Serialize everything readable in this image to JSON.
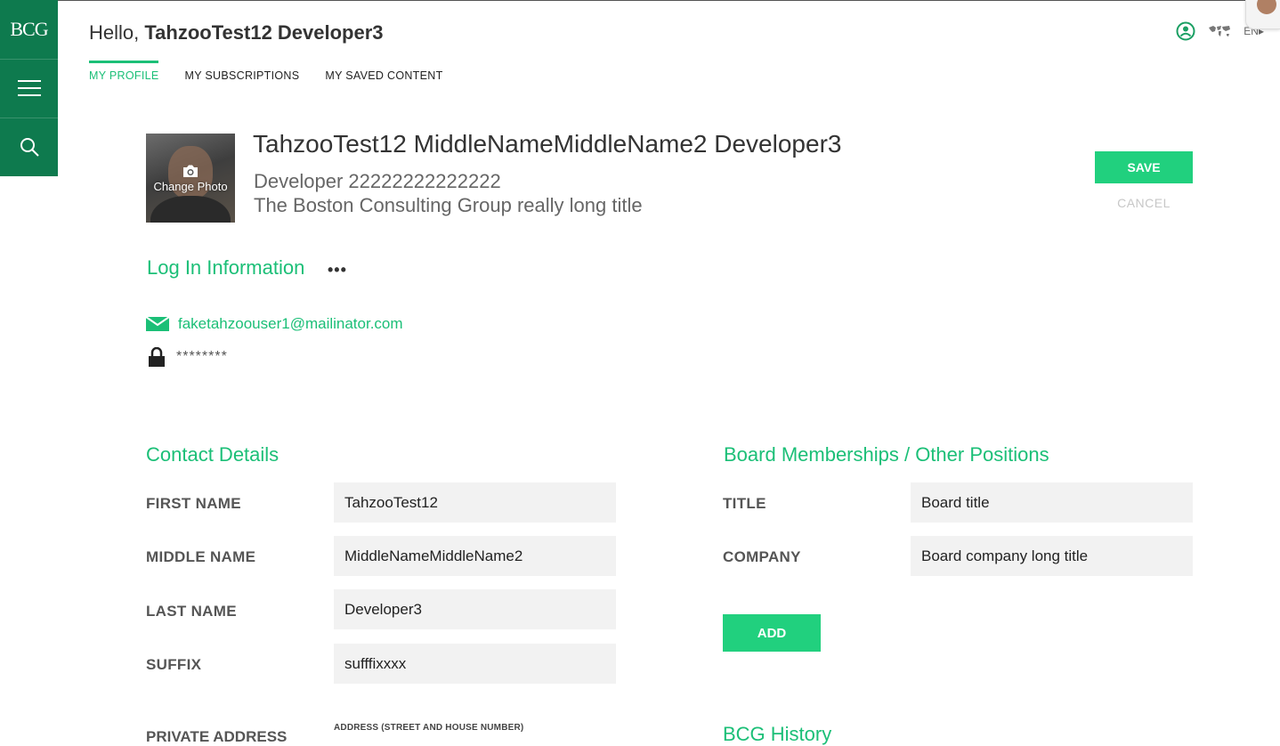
{
  "brand": {
    "logo_text": "BCG",
    "accent": "#1bbf77",
    "button_green": "#21d07e",
    "rail_green": "#0e7a4e"
  },
  "rail": {
    "menu_icon": "hamburger-icon",
    "search_icon": "search-icon"
  },
  "header": {
    "greeting": "Hello,",
    "user_name": "TahzooTest12 Developer3",
    "language": "EN",
    "tabs": [
      {
        "label": "MY PROFILE",
        "active": true
      },
      {
        "label": "MY SUBSCRIPTIONS",
        "active": false
      },
      {
        "label": "MY SAVED CONTENT",
        "active": false
      }
    ]
  },
  "profile": {
    "change_photo": "Change Photo",
    "full_name": "TahzooTest12 MiddleNameMiddleName2 Developer3",
    "role": "Developer 22222222222222",
    "company": "The Boston Consulting Group really long title",
    "save_label": "SAVE",
    "cancel_label": "CANCEL"
  },
  "login_info": {
    "title": "Log In Information",
    "more": "•••",
    "email": "faketahzoouser1@mailinator.com",
    "password": "********"
  },
  "contact": {
    "title": "Contact Details",
    "fields": [
      {
        "label": "FIRST NAME",
        "value": "TahzooTest12"
      },
      {
        "label": "MIDDLE NAME",
        "value": "MiddleNameMiddleName2"
      },
      {
        "label": "LAST NAME",
        "value": "Developer3"
      },
      {
        "label": "SUFFIX",
        "value": "sufffixxxx"
      }
    ],
    "private_address_label": "PRIVATE ADDRESS",
    "address_sub_label": "ADDRESS (STREET AND HOUSE NUMBER)"
  },
  "board": {
    "title": "Board Memberships / Other Positions",
    "fields": [
      {
        "label": "TITLE",
        "value": "Board title"
      },
      {
        "label": "COMPANY",
        "value": "Board company long title"
      }
    ],
    "add_label": "ADD",
    "next_section_title": "BCG History"
  }
}
